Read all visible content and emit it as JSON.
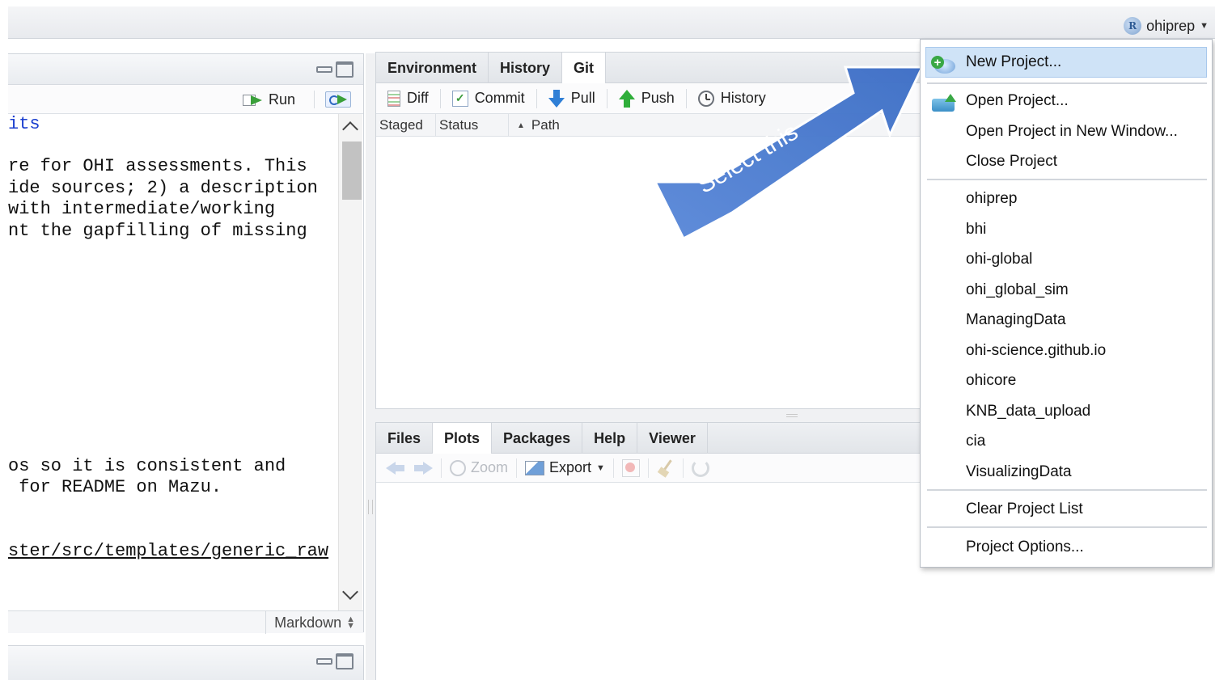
{
  "topbar": {
    "project_name": "ohiprep",
    "project_logo_letter": "R"
  },
  "source_pane": {
    "toolbar": {
      "run_label": "Run"
    },
    "code_lines": [
      "its",
      "re for OHI assessments. This",
      "ide sources; 2) a description",
      "with intermediate/working",
      "nt the gapfilling of missing",
      "os so it is consistent and",
      " for README on Mazu.",
      "ster/src/templates/generic_raw"
    ],
    "language_mode": "Markdown"
  },
  "env_pane": {
    "tabs": [
      {
        "label": "Environment"
      },
      {
        "label": "History"
      },
      {
        "label": "Git"
      }
    ],
    "active_tab": "Git",
    "git_toolbar": {
      "diff_label": "Diff",
      "commit_label": "Commit",
      "pull_label": "Pull",
      "push_label": "Push",
      "history_label": "History"
    },
    "columns": [
      "Staged",
      "Status",
      "Path"
    ]
  },
  "files_pane": {
    "tabs": [
      {
        "label": "Files"
      },
      {
        "label": "Plots"
      },
      {
        "label": "Packages"
      },
      {
        "label": "Help"
      },
      {
        "label": "Viewer"
      }
    ],
    "active_tab": "Plots",
    "toolbar": {
      "zoom_label": "Zoom",
      "export_label": "Export"
    }
  },
  "project_menu": {
    "new_project": "New Project...",
    "open_project": "Open Project...",
    "open_in_new_window": "Open Project in New Window...",
    "close_project": "Close Project",
    "recent_projects": [
      "ohiprep",
      "bhi",
      "ohi-global",
      "ohi_global_sim",
      "ManagingData",
      "ohi-science.github.io",
      "ohicore",
      "KNB_data_upload",
      "cia",
      "VisualizingData"
    ],
    "clear_list": "Clear Project List",
    "project_options": "Project Options..."
  },
  "callout": {
    "text": "Select this",
    "color": "#4a7bd0"
  }
}
